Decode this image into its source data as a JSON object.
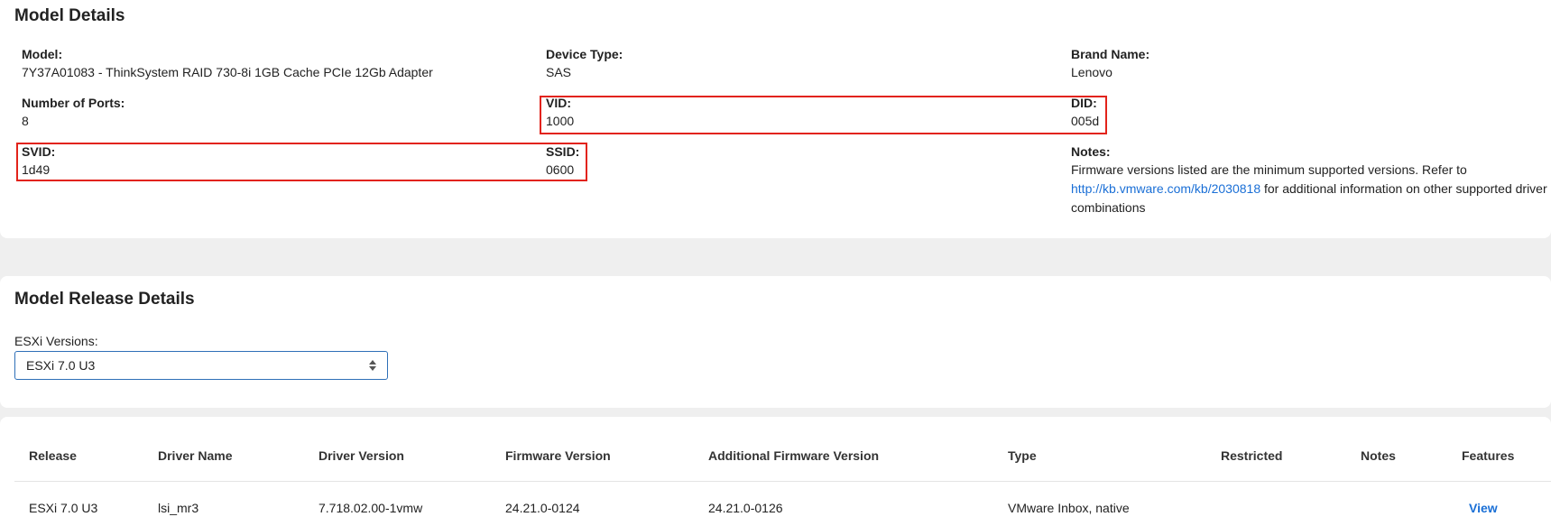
{
  "model_details": {
    "title": "Model Details",
    "model": {
      "label": "Model:",
      "value": "7Y37A01083 - ThinkSystem RAID 730-8i 1GB Cache PCIe 12Gb Adapter"
    },
    "device_type": {
      "label": "Device Type:",
      "value": "SAS"
    },
    "brand_name": {
      "label": "Brand Name:",
      "value": "Lenovo"
    },
    "number_of_ports": {
      "label": "Number of Ports:",
      "value": "8"
    },
    "vid": {
      "label": "VID:",
      "value": "1000"
    },
    "did": {
      "label": "DID:",
      "value": "005d"
    },
    "svid": {
      "label": "SVID:",
      "value": "1d49"
    },
    "ssid": {
      "label": "SSID:",
      "value": "0600"
    },
    "notes": {
      "label": "Notes:",
      "text_before": "Firmware versions listed are the minimum supported versions. Refer to ",
      "link_text": "http://kb.vmware.com/kb/2030818",
      "text_after": " for additional information on other supported driver and firmware combinations"
    }
  },
  "model_release": {
    "title": "Model Release Details",
    "esxi_label": "ESXi Versions:",
    "esxi_selected": "ESXi 7.0 U3"
  },
  "table": {
    "headers": {
      "release": "Release",
      "driver_name": "Driver Name",
      "driver_version": "Driver Version",
      "firmware_version": "Firmware Version",
      "additional_firmware_version": "Additional Firmware Version",
      "type": "Type",
      "restricted": "Restricted",
      "notes": "Notes",
      "features": "Features"
    },
    "rows": [
      {
        "release": "ESXi 7.0 U3",
        "driver_name": "lsi_mr3",
        "driver_version": "7.718.02.00-1vmw",
        "firmware_version": "24.21.0-0124",
        "additional_firmware_version": "24.21.0-0126",
        "type": "VMware Inbox, native",
        "restricted": "",
        "notes": "",
        "features": "View"
      }
    ]
  },
  "colors": {
    "highlight": "#e2231a",
    "link": "#1a6fd6",
    "select_border": "#2e6fb7"
  }
}
